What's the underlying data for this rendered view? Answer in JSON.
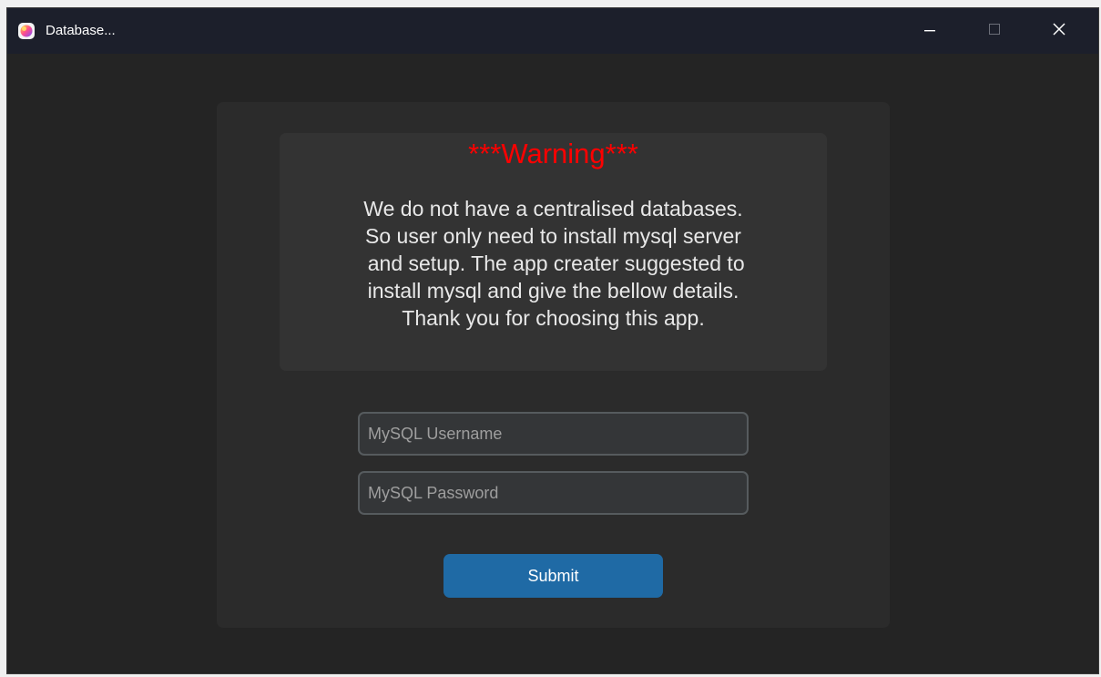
{
  "window": {
    "title": "Database...",
    "controls": {
      "minimize_icon": "minimize-icon",
      "maximize_icon": "maximize-icon",
      "close_icon": "close-icon"
    }
  },
  "warning": {
    "title": "***Warning***",
    "lines": [
      "We do not have a centralised databases.",
      "So user only need to install mysql server",
      " and setup. The app creater suggested to",
      "install mysql and give the bellow details.",
      "Thank you for choosing this app."
    ]
  },
  "form": {
    "username": {
      "value": "",
      "placeholder": "MySQL Username"
    },
    "password": {
      "value": "",
      "placeholder": "MySQL Password"
    },
    "submit_label": "Submit"
  },
  "colors": {
    "warning_title": "#ff0000",
    "accent_button": "#1f6aa5",
    "window_background": "#242424",
    "card_background": "#2b2b2b",
    "titlebar_background": "#1c1f2b"
  }
}
